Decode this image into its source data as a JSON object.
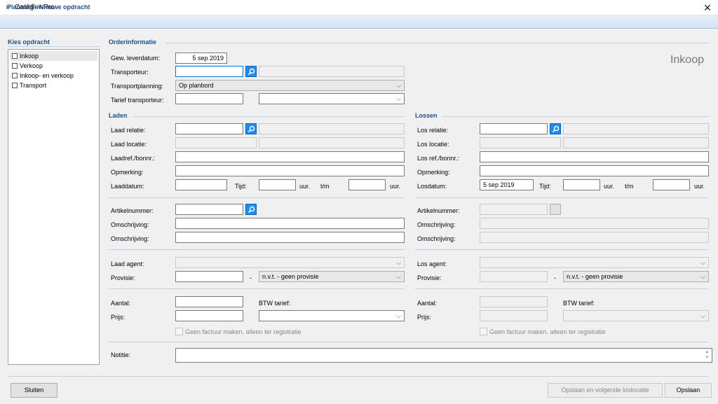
{
  "window": {
    "app_title": "CashflowPro",
    "close_label": "✕"
  },
  "header": {
    "title": "Planning - Nieuwe opdracht"
  },
  "sidebar": {
    "title": "Kies opdracht",
    "items": [
      {
        "label": "Inkoop"
      },
      {
        "label": "Verkoop"
      },
      {
        "label": "Inkoop- en verkoop"
      },
      {
        "label": "Transport"
      }
    ]
  },
  "order": {
    "section_title": "Orderinformatie",
    "type_label": "Inkoop",
    "leverdatum_label": "Gew. leverdatum:",
    "leverdatum_value": "5 sep 2019",
    "transporteur_label": "Transporteur:",
    "transportplanning_label": "Transportplanning:",
    "transportplanning_value": "Op planbord",
    "tarief_label": "Tarief transporteur:"
  },
  "laden": {
    "section_title": "Laden",
    "relatie_label": "Laad relatie:",
    "locatie_label": "Laad locatie:",
    "ref_label": "Laadref./bonnr.:",
    "opmerking_label": "Opmerking:",
    "datum_label": "Laaddatum:",
    "tijd_label": "Tijd:",
    "uur1": "uur.",
    "tm": "t/m",
    "uur2": "uur."
  },
  "lossen": {
    "section_title": "Lossen",
    "relatie_label": "Los relatie:",
    "locatie_label": "Los locatie:",
    "ref_label": "Los ref./bonnr.:",
    "opmerking_label": "Opmerking:",
    "datum_label": "Losdatum:",
    "datum_value": "5 sep 2019",
    "tijd_label": "Tijd:",
    "uur1": "uur.",
    "tm": "t/m",
    "uur2": "uur."
  },
  "article_left": {
    "artikel_label": "Artikelnummer:",
    "omschrijving1_label": "Omschrijving:",
    "omschrijving2_label": "Omschrijving:"
  },
  "article_right": {
    "artikel_label": "Artikelnummer:",
    "omschrijving1_label": "Omschrijving:",
    "omschrijving2_label": "Omschrijving:"
  },
  "agent_left": {
    "agent_label": "Laad agent:",
    "provisie_label": "Provisie:",
    "dash": "-",
    "provisie_select": "n.v.t. - geen provisie"
  },
  "agent_right": {
    "agent_label": "Los agent:",
    "provisie_label": "Provisie:",
    "dash": "-",
    "provisie_select": "n.v.t. - geen provisie"
  },
  "price_left": {
    "aantal_label": "Aantal:",
    "btw_label": "BTW tarief:",
    "prijs_label": "Prijs:",
    "checkbox_label": "Geen factuur maken, alleen ter registratie"
  },
  "price_right": {
    "aantal_label": "Aantal:",
    "btw_label": "BTW tarief:",
    "prijs_label": "Prijs:",
    "checkbox_label": "Geen factuur maken, alleen ter registratie"
  },
  "notes": {
    "label": "Notitie:"
  },
  "footer": {
    "close_button": "Sluiten",
    "save_next_button": "Opslaan en volgende loslocatie",
    "save_button": "Opslaan"
  }
}
